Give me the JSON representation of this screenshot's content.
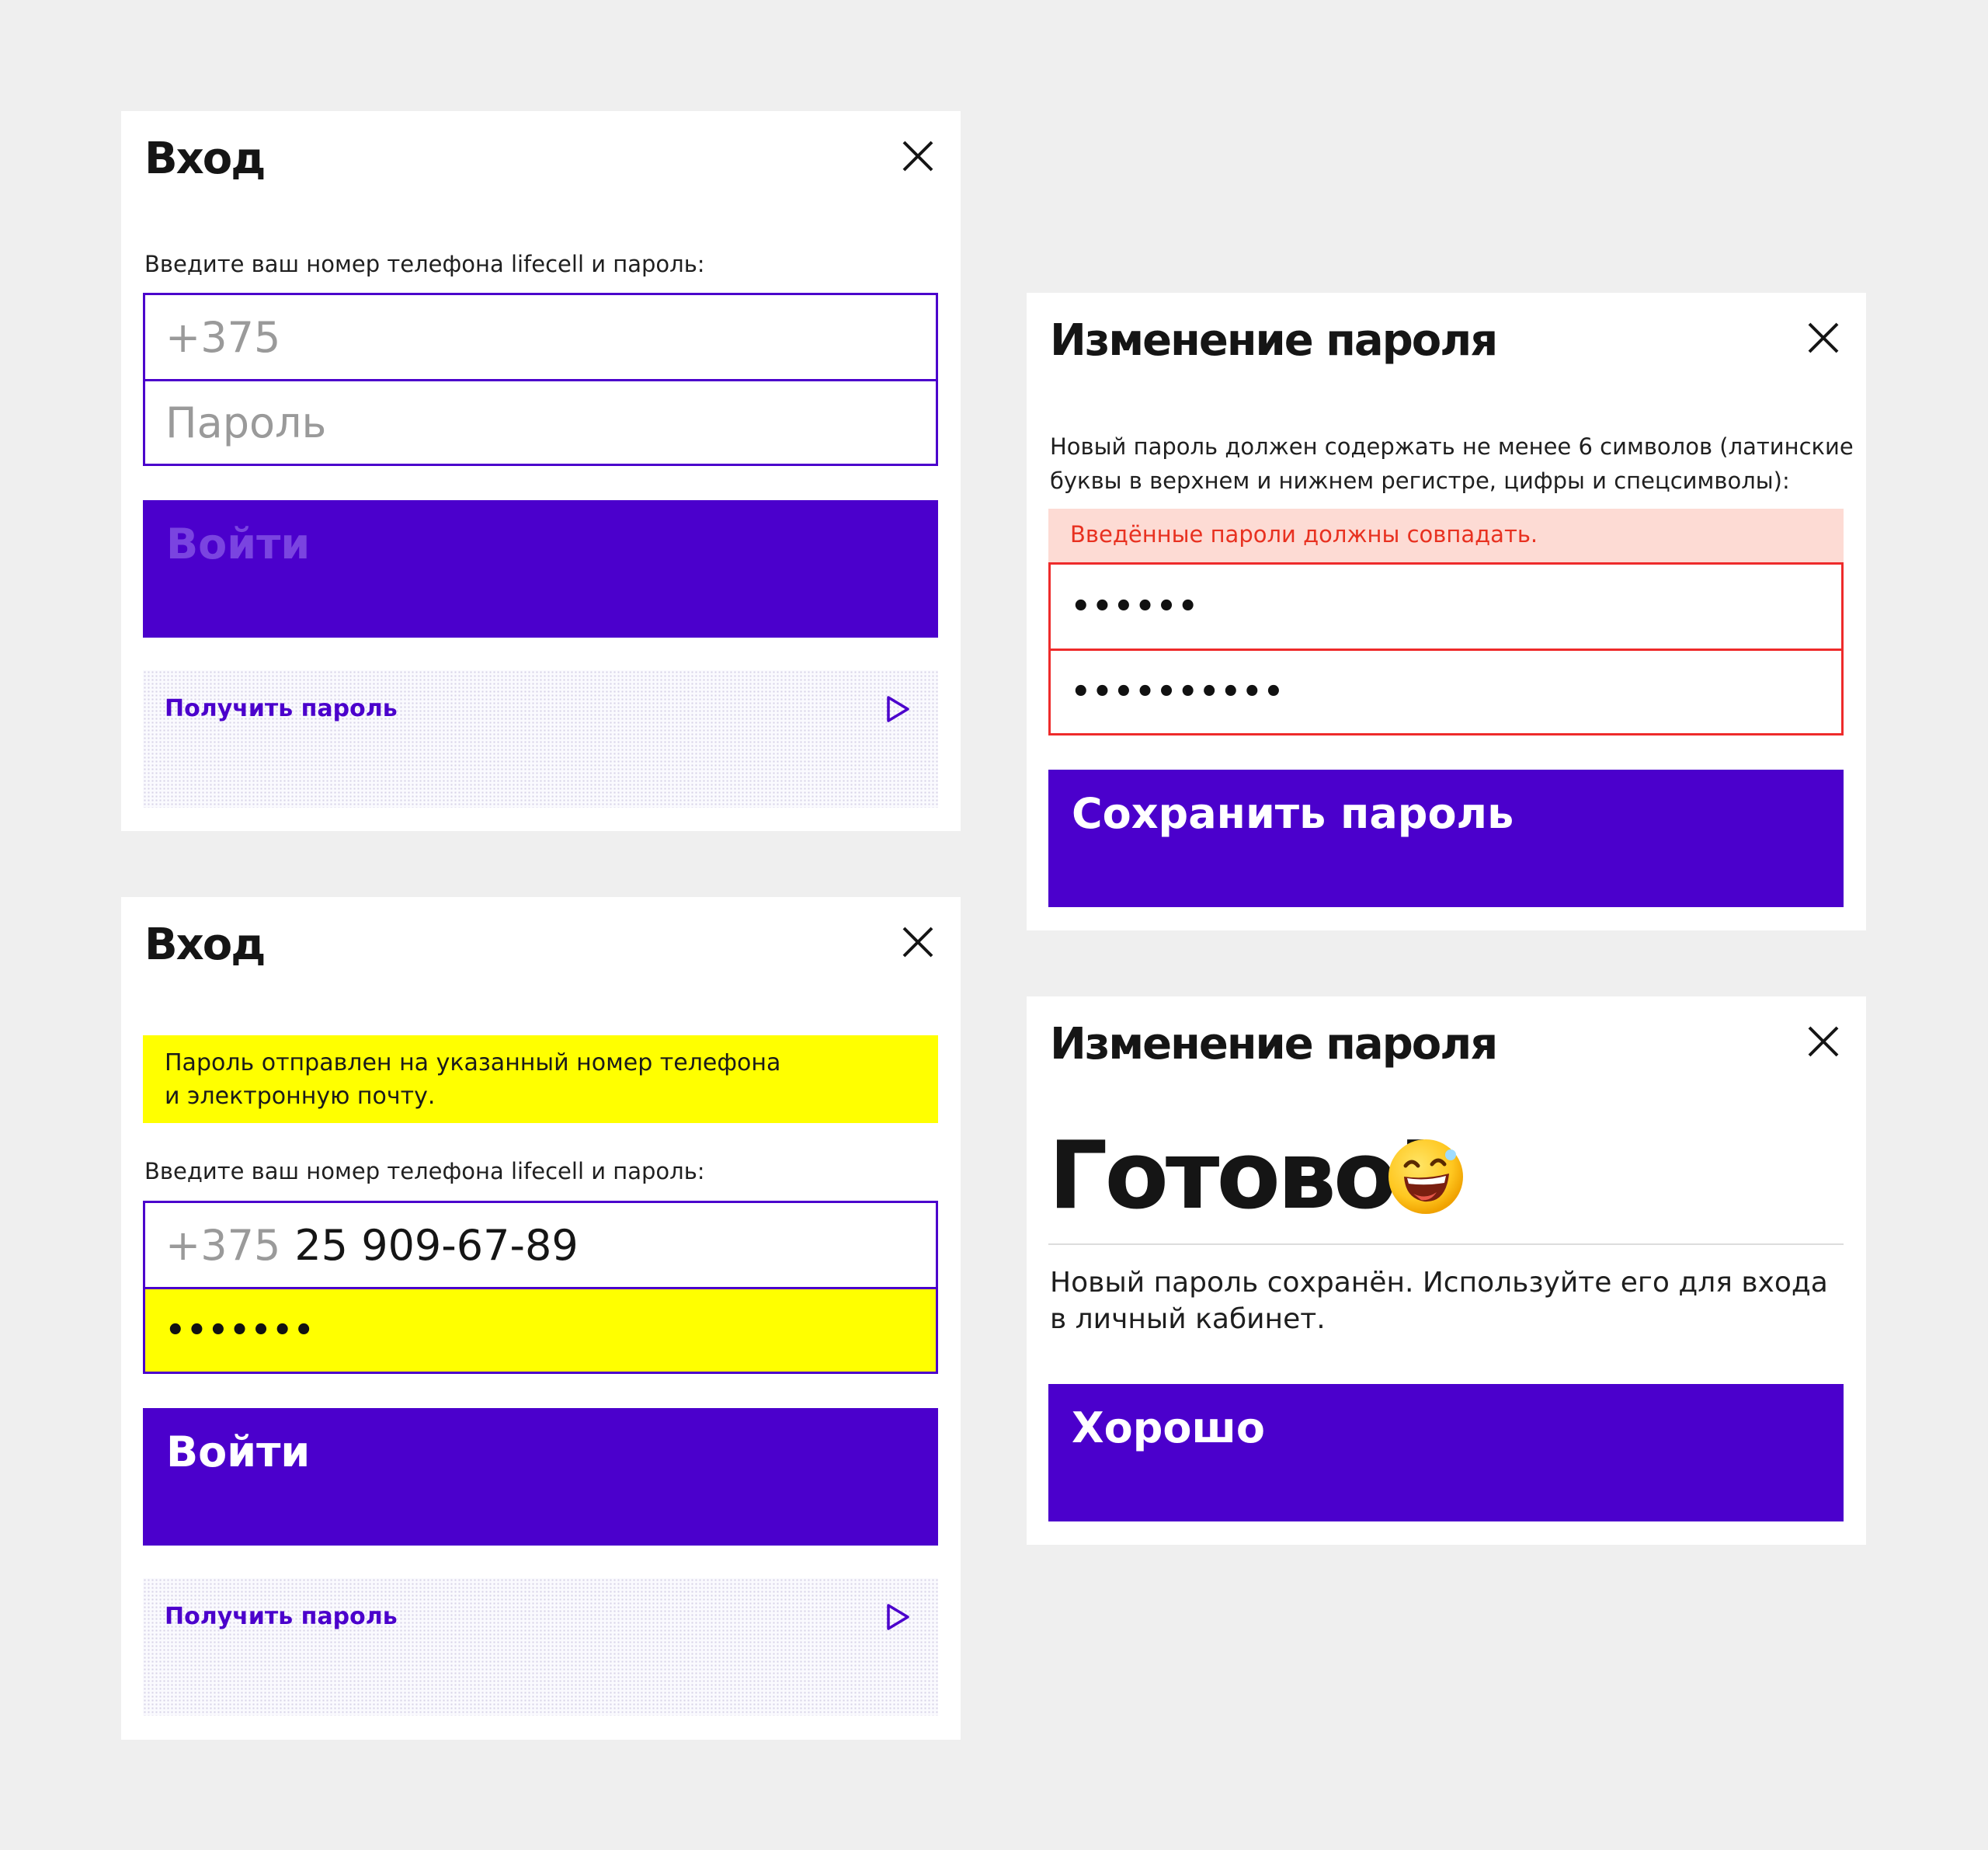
{
  "colors": {
    "accent": "#4b00cc",
    "error": "#ee2b2b",
    "error_bg": "#fddbd4",
    "notice_bg": "#ffff00",
    "page_bg": "#efefef"
  },
  "login_empty": {
    "title": "Вход",
    "hint": "Введите ваш номер телефона lifecell и пароль:",
    "phone_placeholder": "+375",
    "password_placeholder": "Пароль",
    "submit_label": "Войти",
    "get_password_label": "Получить пароль"
  },
  "login_filled": {
    "title": "Вход",
    "notice_line1": "Пароль отправлен на указанный номер телефона",
    "notice_line2": "и электронную почту.",
    "hint": "Введите ваш номер телефона lifecell и пароль:",
    "phone_prefix": "+375",
    "phone_value": "25 909-67-89",
    "password_value": "•••••••",
    "submit_label": "Войти",
    "get_password_label": "Получить пароль"
  },
  "change_password": {
    "title": "Изменение пароля",
    "hint_line1": "Новый пароль должен содержать не менее 6 символов (латинские",
    "hint_line2": "буквы в верхнем и нижнем регистре, цифры и спецсимволы):",
    "error": "Введённые пароли должны совпадать.",
    "password_value": "••••••",
    "confirm_value": "••••••••••",
    "submit_label": "Сохранить пароль"
  },
  "change_done": {
    "title": "Изменение пароля",
    "heading": "Готово!",
    "message_line1": "Новый пароль сохранён. Используйте его для входа",
    "message_line2": "в личный кабинет.",
    "ok_label": "Хорошо"
  },
  "icons": [
    "close-icon",
    "play-arrow-icon",
    "laughing-emoji-icon"
  ]
}
